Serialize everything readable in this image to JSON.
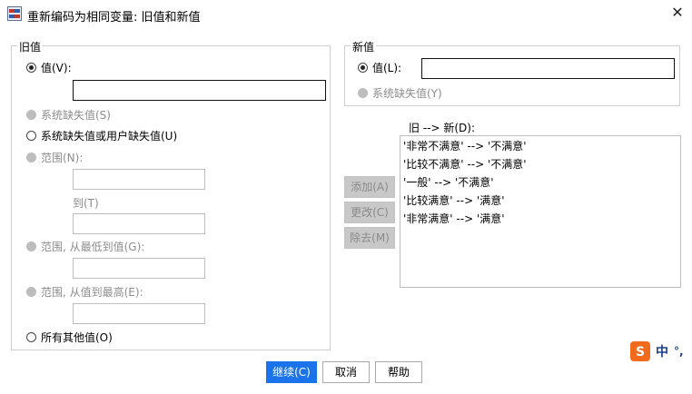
{
  "window": {
    "title": "重新编码为相同变量: 旧值和新值"
  },
  "old_value": {
    "legend": "旧值",
    "value_label": "值(V):",
    "value_text": "",
    "system_missing_label": "系统缺失值(S)",
    "system_or_user_missing_label": "系统缺失值或用户缺失值(U)",
    "range_label": "范围(N):",
    "range_from": "",
    "to_label": "到(T)",
    "range_to": "",
    "range_lowest_label": "范围, 从最低到值(G):",
    "range_lowest_value": "",
    "range_highest_label": "范围, 从值到最高(E):",
    "range_highest_value": "",
    "all_other_label": "所有其他值(O)"
  },
  "new_value": {
    "legend": "新值",
    "value_label": "值(L):",
    "value_text": "",
    "system_missing_label": "系统缺失值(Y)"
  },
  "mapping": {
    "label": "旧 --> 新(D):",
    "add_label": "添加(A)",
    "change_label": "更改(C)",
    "remove_label": "除去(M)",
    "items": [
      "'非常不满意' --> '不满意'",
      "'比较不满意' --> '不满意'",
      "'一般' --> '不满意'",
      "'比较满意' --> '满意'",
      "'非常满意' --> '满意'"
    ]
  },
  "footer": {
    "continue_label": "继续(C)",
    "cancel_label": "取消",
    "help_label": "帮助"
  },
  "ime": {
    "mode_label": "中",
    "punct_label": "°,"
  },
  "colors": {
    "accent": "#1a73e8",
    "ime_orange": "#f26b1d"
  },
  "icons": [
    "app-icon",
    "close-icon",
    "sogou-ime-icon"
  ]
}
